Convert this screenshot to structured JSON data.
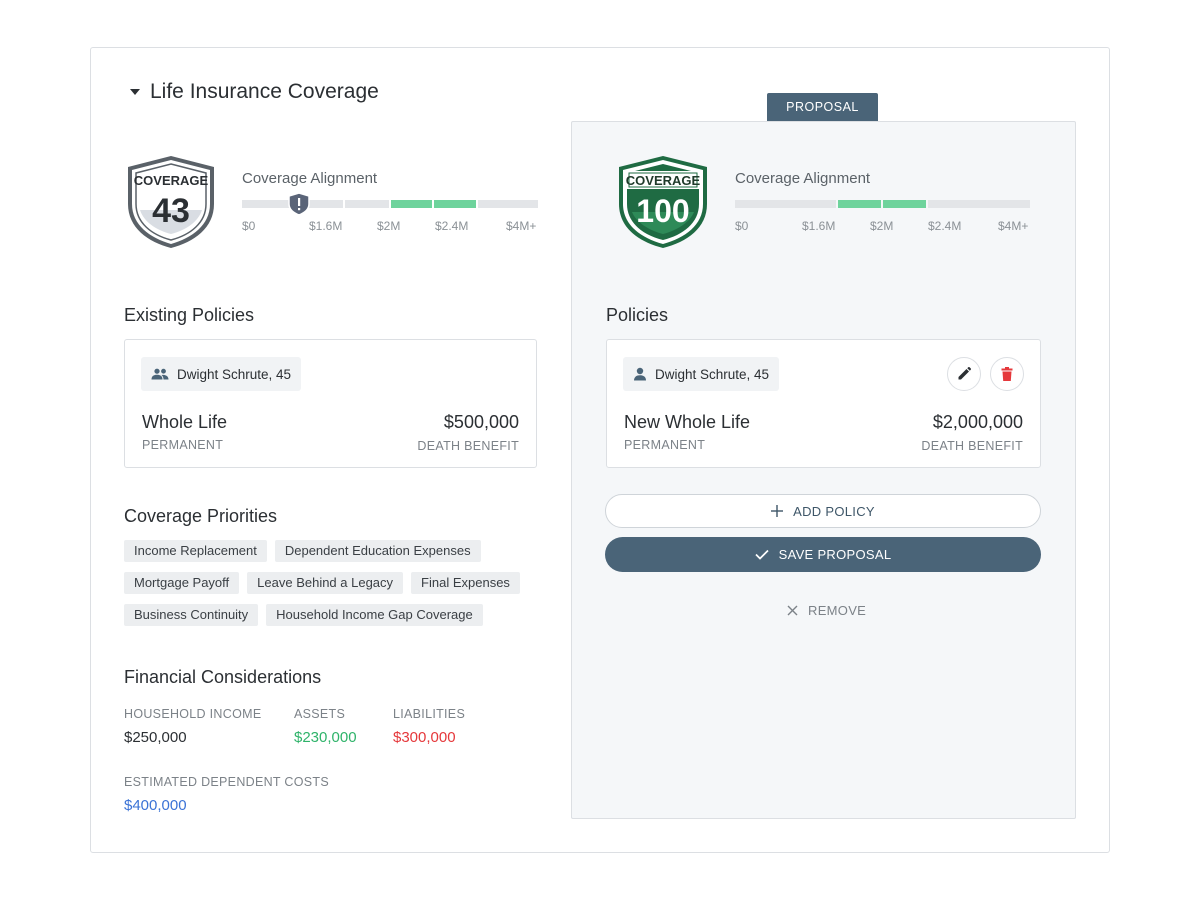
{
  "section": {
    "title": "Life Insurance Coverage"
  },
  "existing": {
    "shield": {
      "label": "COVERAGE",
      "score": "43"
    },
    "alignment": {
      "label": "Coverage Alignment",
      "ticks": [
        "$0",
        "$1.6M",
        "$2M",
        "$2.4M",
        "$4M+"
      ],
      "marker_value_millions": 1.1,
      "target_range_millions": [
        2.0,
        2.4
      ]
    },
    "heading": "Existing Policies",
    "policy": {
      "person": "Dwight Schrute, 45",
      "name": "Whole Life",
      "type": "PERMANENT",
      "amount": "$500,000",
      "amount_label": "DEATH BENEFIT"
    }
  },
  "priorities": {
    "heading": "Coverage Priorities",
    "rows": [
      [
        "Income Replacement",
        "Dependent Education Expenses"
      ],
      [
        "Mortgage Payoff",
        "Leave Behind a Legacy",
        "Final Expenses"
      ],
      [
        "Business Continuity",
        "Household Income Gap Coverage"
      ]
    ]
  },
  "financial": {
    "heading": "Financial Considerations",
    "household_income_label": "HOUSEHOLD INCOME",
    "household_income": "$250,000",
    "assets_label": "ASSETS",
    "assets": "$230,000",
    "liabilities_label": "LIABILITIES",
    "liabilities": "$300,000",
    "dependent_costs_label": "ESTIMATED DEPENDENT COSTS",
    "dependent_costs": "$400,000",
    "colors": {
      "assets": "#2fb36a",
      "liabilities": "#e5383b",
      "dependent_costs": "#3b73d6"
    }
  },
  "proposal": {
    "tab": "PROPOSAL",
    "shield": {
      "label": "COVERAGE",
      "score": "100",
      "color": "#1f6b43"
    },
    "alignment": {
      "label": "Coverage Alignment",
      "ticks": [
        "$0",
        "$1.6M",
        "$2M",
        "$2.4M",
        "$4M+"
      ],
      "target_range_millions": [
        2.0,
        2.4
      ]
    },
    "heading": "Policies",
    "policy": {
      "person": "Dwight Schrute, 45",
      "name": "New Whole Life",
      "type": "PERMANENT",
      "amount": "$2,000,000",
      "amount_label": "DEATH BENEFIT"
    },
    "add_policy": "ADD POLICY",
    "save_proposal": "SAVE PROPOSAL",
    "remove": "REMOVE",
    "icons": {
      "edit": "pencil-icon",
      "delete": "trash-icon",
      "add": "plus-icon",
      "save": "check-icon",
      "remove": "close-icon"
    }
  }
}
